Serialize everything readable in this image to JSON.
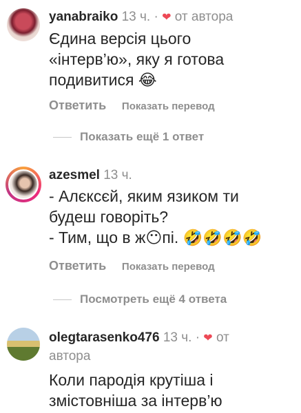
{
  "comments": [
    {
      "username": "yanabraiko",
      "time": "13 ч.",
      "author_badge": "от автора",
      "text_lines": [
        "Єдина версія цього",
        "«інтерв’ю», яку я готова",
        "подивитися 😂"
      ],
      "reply_label": "Ответить",
      "translate_label": "Показать перевод"
    },
    {
      "username": "azesmel",
      "time": "13 ч.",
      "text_lines": [
        "- Алєксєй, яким язиком ти",
        "будеш говоріть?",
        "- Тим, що в ж😶пі. 🤣🤣🤣🤣"
      ],
      "reply_label": "Ответить",
      "translate_label": "Показать перевод"
    },
    {
      "username": "olegtarasenko476",
      "time": "13 ч.",
      "author_badge_line1": "от",
      "author_badge_line2": "автора",
      "text_lines": [
        "Коли пародія крутіша і",
        "змістовніша за інтерв’ю"
      ]
    }
  ],
  "view_more_1": "Показать ещё 1 ответ",
  "view_more_2": "Посмотреть ещё 4 ответа",
  "colors": {
    "heart": "#ed4956",
    "muted": "#8e8e8e",
    "text": "#262626"
  },
  "icons": {
    "heart": "heart-icon",
    "separator": "dot-separator"
  }
}
